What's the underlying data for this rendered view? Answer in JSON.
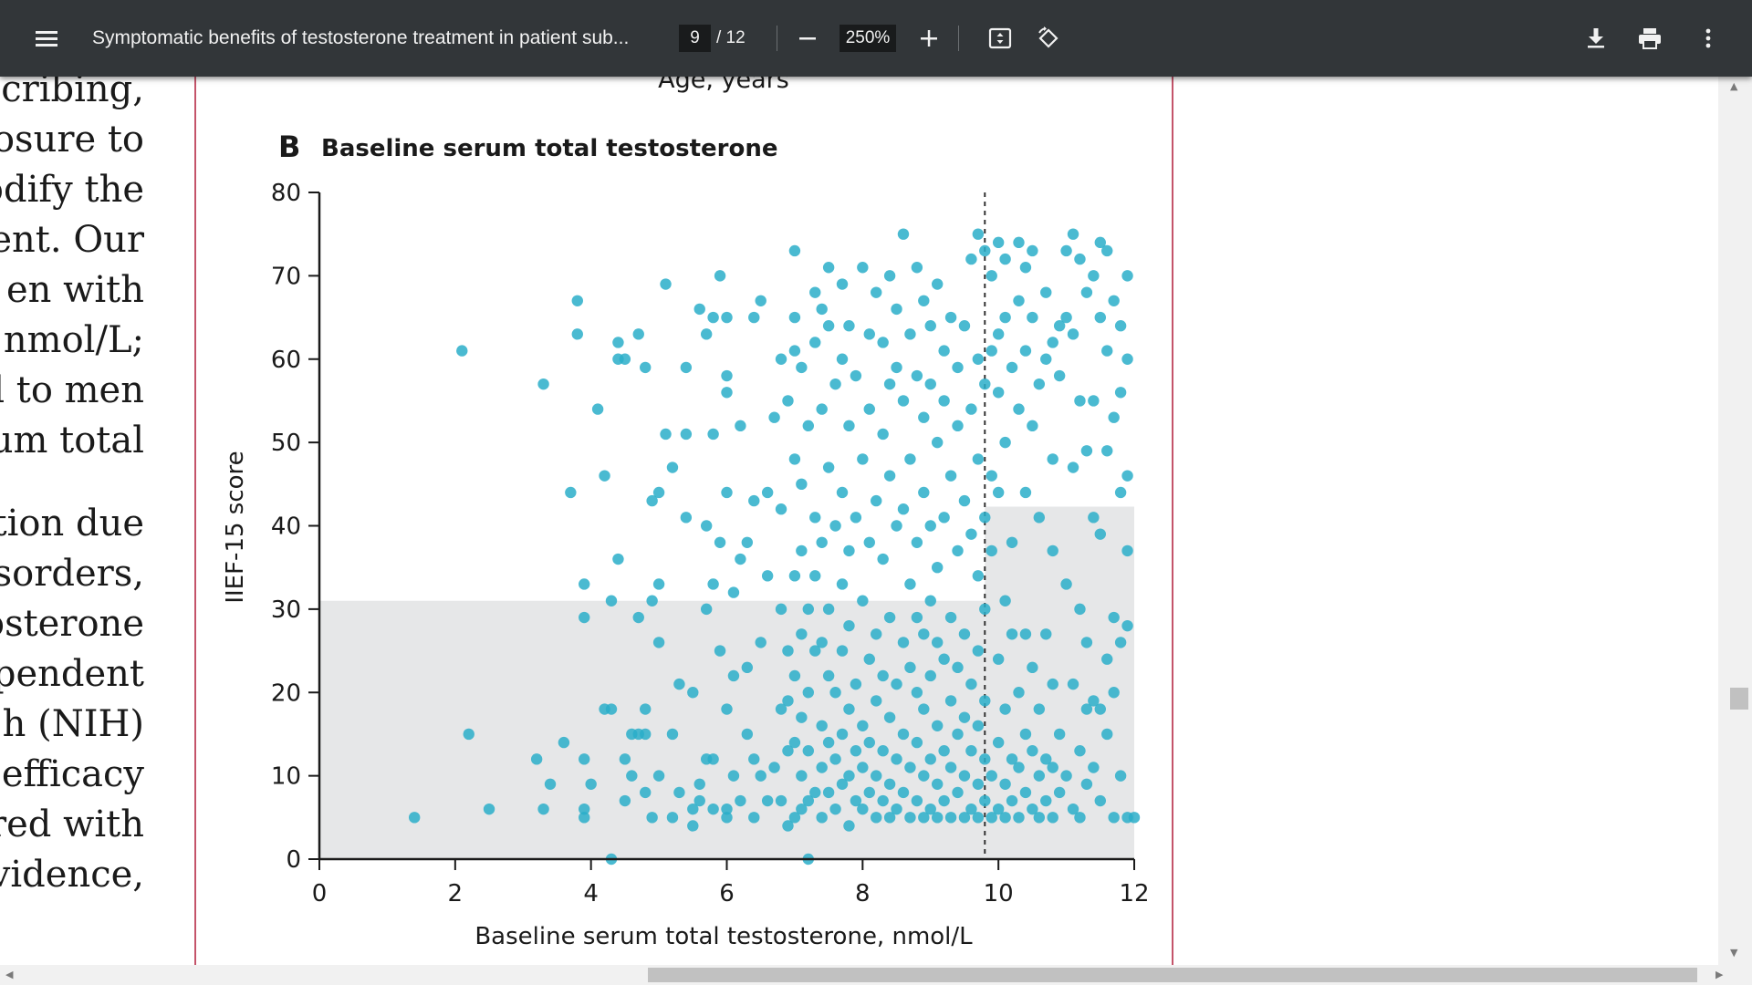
{
  "toolbar": {
    "menu_icon": "hamburger-menu-icon",
    "title": "Symptomatic benefits of testosterone treatment in patient sub...",
    "current_page": "9",
    "total_pages": "/ 12",
    "zoom": "250%",
    "icons": [
      "zoom-out-icon",
      "zoom-in-icon",
      "fit-page-icon",
      "rotate-icon",
      "download-icon",
      "print-icon",
      "more-vert-icon"
    ]
  },
  "left_text_lines": [
    "scribing,",
    "osure to",
    "odify the",
    "ent. Our",
    "en   with",
    "nmol/L;",
    "d to men",
    "um total",
    "tion due",
    "isorders,",
    "osterone",
    "pendent",
    "h  (NIH)",
    "efficacy",
    "red with",
    "vidence,"
  ],
  "figure": {
    "previous_xlabel": "Age, years",
    "panel_label": "B",
    "panel_title": "Baseline serum total testosterone"
  },
  "chart_data": {
    "type": "scatter",
    "title": "Baseline serum total testosterone",
    "xlabel": "Baseline serum total testosterone, nmol/L",
    "ylabel": "IIEF-15 score",
    "xlim": [
      0,
      12
    ],
    "ylim": [
      0,
      80
    ],
    "xticks": [
      "0",
      "2",
      "4",
      "6",
      "8",
      "10",
      "12"
    ],
    "yticks": [
      "0",
      "10",
      "20",
      "30",
      "40",
      "50",
      "60",
      "70",
      "80"
    ],
    "reference_line_x": 9.8,
    "shaded_regions": [
      {
        "x0": 0,
        "x1": 9.8,
        "y0": 0,
        "y1": 31
      },
      {
        "x0": 9.8,
        "x1": 12,
        "y0": 0,
        "y1": 42.3
      }
    ],
    "point_color": "#2aaec9",
    "shade_color": "#e6e7e8",
    "points": [
      [
        1.4,
        5
      ],
      [
        2.1,
        61
      ],
      [
        2.2,
        15
      ],
      [
        2.5,
        6
      ],
      [
        3.3,
        57
      ],
      [
        3.2,
        12
      ],
      [
        3.3,
        6
      ],
      [
        3.4,
        9
      ],
      [
        3.6,
        14
      ],
      [
        3.7,
        44
      ],
      [
        3.8,
        67
      ],
      [
        3.8,
        63
      ],
      [
        3.9,
        6
      ],
      [
        3.9,
        12
      ],
      [
        3.9,
        29
      ],
      [
        3.9,
        33
      ],
      [
        3.9,
        5
      ],
      [
        4.0,
        9
      ],
      [
        4.1,
        54
      ],
      [
        4.2,
        18
      ],
      [
        4.2,
        46
      ],
      [
        4.3,
        18
      ],
      [
        4.3,
        31
      ],
      [
        4.3,
        0
      ],
      [
        4.4,
        36
      ],
      [
        4.4,
        62
      ],
      [
        4.4,
        60
      ],
      [
        4.5,
        7
      ],
      [
        4.5,
        12
      ],
      [
        4.5,
        60
      ],
      [
        4.6,
        15
      ],
      [
        4.6,
        10
      ],
      [
        4.7,
        15
      ],
      [
        4.7,
        29
      ],
      [
        4.7,
        63
      ],
      [
        4.8,
        59
      ],
      [
        4.8,
        18
      ],
      [
        4.8,
        8
      ],
      [
        4.8,
        15
      ],
      [
        4.9,
        31
      ],
      [
        4.9,
        43
      ],
      [
        4.9,
        5
      ],
      [
        5.0,
        10
      ],
      [
        5.0,
        44
      ],
      [
        5.0,
        33
      ],
      [
        5.0,
        26
      ],
      [
        5.1,
        51
      ],
      [
        5.1,
        69
      ],
      [
        5.2,
        47
      ],
      [
        5.2,
        15
      ],
      [
        5.2,
        5
      ],
      [
        5.3,
        8
      ],
      [
        5.3,
        21
      ],
      [
        5.4,
        41
      ],
      [
        5.4,
        51
      ],
      [
        5.4,
        59
      ],
      [
        5.5,
        6
      ],
      [
        5.5,
        4
      ],
      [
        5.5,
        20
      ],
      [
        5.6,
        9
      ],
      [
        5.6,
        66
      ],
      [
        5.6,
        7
      ],
      [
        5.7,
        12
      ],
      [
        5.7,
        63
      ],
      [
        5.7,
        40
      ],
      [
        5.7,
        30
      ],
      [
        5.8,
        65
      ],
      [
        5.8,
        51
      ],
      [
        5.8,
        33
      ],
      [
        5.8,
        6
      ],
      [
        5.8,
        12
      ],
      [
        5.9,
        25
      ],
      [
        5.9,
        38
      ],
      [
        5.9,
        70
      ],
      [
        6.0,
        6
      ],
      [
        6.0,
        5
      ],
      [
        6.0,
        56
      ],
      [
        6.0,
        18
      ],
      [
        6.0,
        44
      ],
      [
        6.0,
        58
      ],
      [
        6.0,
        65
      ],
      [
        6.1,
        10
      ],
      [
        6.1,
        22
      ],
      [
        6.1,
        32
      ],
      [
        6.2,
        36
      ],
      [
        6.2,
        7
      ],
      [
        6.2,
        52
      ],
      [
        6.3,
        15
      ],
      [
        6.3,
        23
      ],
      [
        6.3,
        38
      ],
      [
        6.4,
        12
      ],
      [
        6.4,
        5
      ],
      [
        6.4,
        43
      ],
      [
        6.4,
        65
      ],
      [
        6.5,
        10
      ],
      [
        6.5,
        26
      ],
      [
        6.5,
        67
      ],
      [
        6.6,
        7
      ],
      [
        6.6,
        34
      ],
      [
        6.6,
        44
      ],
      [
        6.7,
        11
      ],
      [
        6.7,
        53
      ],
      [
        6.8,
        7
      ],
      [
        6.8,
        18
      ],
      [
        6.8,
        30
      ],
      [
        6.8,
        42
      ],
      [
        6.8,
        60
      ],
      [
        6.9,
        4
      ],
      [
        6.9,
        13
      ],
      [
        6.9,
        19
      ],
      [
        6.9,
        25
      ],
      [
        6.9,
        55
      ],
      [
        7.0,
        5
      ],
      [
        7.0,
        14
      ],
      [
        7.0,
        22
      ],
      [
        7.0,
        34
      ],
      [
        7.0,
        48
      ],
      [
        7.0,
        61
      ],
      [
        7.0,
        65
      ],
      [
        7.0,
        73
      ],
      [
        7.1,
        6
      ],
      [
        7.1,
        10
      ],
      [
        7.1,
        17
      ],
      [
        7.1,
        27
      ],
      [
        7.1,
        37
      ],
      [
        7.1,
        45
      ],
      [
        7.1,
        59
      ],
      [
        7.2,
        7
      ],
      [
        7.2,
        13
      ],
      [
        7.2,
        20
      ],
      [
        7.2,
        30
      ],
      [
        7.2,
        52
      ],
      [
        7.2,
        0
      ],
      [
        7.3,
        8
      ],
      [
        7.3,
        25
      ],
      [
        7.3,
        34
      ],
      [
        7.3,
        41
      ],
      [
        7.3,
        62
      ],
      [
        7.3,
        68
      ],
      [
        7.4,
        5
      ],
      [
        7.4,
        11
      ],
      [
        7.4,
        16
      ],
      [
        7.4,
        26
      ],
      [
        7.4,
        38
      ],
      [
        7.4,
        54
      ],
      [
        7.4,
        66
      ],
      [
        7.5,
        8
      ],
      [
        7.5,
        14
      ],
      [
        7.5,
        22
      ],
      [
        7.5,
        30
      ],
      [
        7.5,
        47
      ],
      [
        7.5,
        64
      ],
      [
        7.5,
        71
      ],
      [
        7.6,
        6
      ],
      [
        7.6,
        12
      ],
      [
        7.6,
        20
      ],
      [
        7.6,
        40
      ],
      [
        7.6,
        57
      ],
      [
        7.7,
        9
      ],
      [
        7.7,
        15
      ],
      [
        7.7,
        25
      ],
      [
        7.7,
        33
      ],
      [
        7.7,
        44
      ],
      [
        7.7,
        60
      ],
      [
        7.7,
        69
      ],
      [
        7.8,
        4
      ],
      [
        7.8,
        10
      ],
      [
        7.8,
        18
      ],
      [
        7.8,
        28
      ],
      [
        7.8,
        37
      ],
      [
        7.8,
        52
      ],
      [
        7.8,
        64
      ],
      [
        7.9,
        7
      ],
      [
        7.9,
        13
      ],
      [
        7.9,
        21
      ],
      [
        7.9,
        41
      ],
      [
        7.9,
        58
      ],
      [
        8.0,
        6
      ],
      [
        8.0,
        11
      ],
      [
        8.0,
        16
      ],
      [
        8.0,
        31
      ],
      [
        8.0,
        48
      ],
      [
        8.0,
        71
      ],
      [
        8.1,
        8
      ],
      [
        8.1,
        14
      ],
      [
        8.1,
        24
      ],
      [
        8.1,
        38
      ],
      [
        8.1,
        54
      ],
      [
        8.1,
        63
      ],
      [
        8.2,
        5
      ],
      [
        8.2,
        10
      ],
      [
        8.2,
        19
      ],
      [
        8.2,
        27
      ],
      [
        8.2,
        43
      ],
      [
        8.2,
        68
      ],
      [
        8.3,
        7
      ],
      [
        8.3,
        13
      ],
      [
        8.3,
        22
      ],
      [
        8.3,
        36
      ],
      [
        8.3,
        51
      ],
      [
        8.3,
        62
      ],
      [
        8.4,
        5
      ],
      [
        8.4,
        9
      ],
      [
        8.4,
        17
      ],
      [
        8.4,
        29
      ],
      [
        8.4,
        46
      ],
      [
        8.4,
        57
      ],
      [
        8.4,
        70
      ],
      [
        8.5,
        6
      ],
      [
        8.5,
        12
      ],
      [
        8.5,
        21
      ],
      [
        8.5,
        40
      ],
      [
        8.5,
        59
      ],
      [
        8.5,
        66
      ],
      [
        8.6,
        8
      ],
      [
        8.6,
        15
      ],
      [
        8.6,
        26
      ],
      [
        8.6,
        42
      ],
      [
        8.6,
        55
      ],
      [
        8.6,
        75
      ],
      [
        8.7,
        5
      ],
      [
        8.7,
        11
      ],
      [
        8.7,
        23
      ],
      [
        8.7,
        33
      ],
      [
        8.7,
        48
      ],
      [
        8.7,
        63
      ],
      [
        8.8,
        7
      ],
      [
        8.8,
        14
      ],
      [
        8.8,
        20
      ],
      [
        8.8,
        29
      ],
      [
        8.8,
        38
      ],
      [
        8.8,
        58
      ],
      [
        8.8,
        71
      ],
      [
        8.9,
        5
      ],
      [
        8.9,
        10
      ],
      [
        8.9,
        18
      ],
      [
        8.9,
        27
      ],
      [
        8.9,
        44
      ],
      [
        8.9,
        53
      ],
      [
        8.9,
        67
      ],
      [
        9.0,
        6
      ],
      [
        9.0,
        12
      ],
      [
        9.0,
        22
      ],
      [
        9.0,
        31
      ],
      [
        9.0,
        40
      ],
      [
        9.0,
        57
      ],
      [
        9.0,
        64
      ],
      [
        9.1,
        5
      ],
      [
        9.1,
        9
      ],
      [
        9.1,
        16
      ],
      [
        9.1,
        26
      ],
      [
        9.1,
        35
      ],
      [
        9.1,
        50
      ],
      [
        9.1,
        69
      ],
      [
        9.2,
        7
      ],
      [
        9.2,
        13
      ],
      [
        9.2,
        24
      ],
      [
        9.2,
        41
      ],
      [
        9.2,
        55
      ],
      [
        9.2,
        61
      ],
      [
        9.3,
        5
      ],
      [
        9.3,
        11
      ],
      [
        9.3,
        19
      ],
      [
        9.3,
        29
      ],
      [
        9.3,
        46
      ],
      [
        9.3,
        65
      ],
      [
        9.4,
        8
      ],
      [
        9.4,
        15
      ],
      [
        9.4,
        23
      ],
      [
        9.4,
        37
      ],
      [
        9.4,
        52
      ],
      [
        9.4,
        59
      ],
      [
        9.5,
        5
      ],
      [
        9.5,
        10
      ],
      [
        9.5,
        17
      ],
      [
        9.5,
        27
      ],
      [
        9.5,
        43
      ],
      [
        9.5,
        64
      ],
      [
        9.6,
        6
      ],
      [
        9.6,
        13
      ],
      [
        9.6,
        21
      ],
      [
        9.6,
        39
      ],
      [
        9.6,
        54
      ],
      [
        9.6,
        72
      ],
      [
        9.7,
        5
      ],
      [
        9.7,
        9
      ],
      [
        9.7,
        16
      ],
      [
        9.7,
        25
      ],
      [
        9.7,
        34
      ],
      [
        9.7,
        48
      ],
      [
        9.7,
        60
      ],
      [
        9.7,
        75
      ],
      [
        9.8,
        7
      ],
      [
        9.8,
        12
      ],
      [
        9.8,
        19
      ],
      [
        9.8,
        30
      ],
      [
        9.8,
        41
      ],
      [
        9.8,
        57
      ],
      [
        9.8,
        73
      ],
      [
        9.9,
        5
      ],
      [
        9.9,
        10
      ],
      [
        9.9,
        37
      ],
      [
        9.9,
        46
      ],
      [
        9.9,
        61
      ],
      [
        9.9,
        70
      ],
      [
        10.0,
        6
      ],
      [
        10.0,
        14
      ],
      [
        10.0,
        24
      ],
      [
        10.0,
        44
      ],
      [
        10.0,
        56
      ],
      [
        10.0,
        63
      ],
      [
        10.0,
        74
      ],
      [
        10.1,
        5
      ],
      [
        10.1,
        9
      ],
      [
        10.1,
        18
      ],
      [
        10.1,
        31
      ],
      [
        10.1,
        50
      ],
      [
        10.1,
        65
      ],
      [
        10.1,
        72
      ],
      [
        10.2,
        7
      ],
      [
        10.2,
        12
      ],
      [
        10.2,
        27
      ],
      [
        10.2,
        38
      ],
      [
        10.2,
        59
      ],
      [
        10.3,
        5
      ],
      [
        10.3,
        11
      ],
      [
        10.3,
        20
      ],
      [
        10.3,
        54
      ],
      [
        10.3,
        67
      ],
      [
        10.3,
        74
      ],
      [
        10.4,
        8
      ],
      [
        10.4,
        15
      ],
      [
        10.4,
        27
      ],
      [
        10.4,
        44
      ],
      [
        10.4,
        61
      ],
      [
        10.4,
        71
      ],
      [
        10.5,
        6
      ],
      [
        10.5,
        13
      ],
      [
        10.5,
        23
      ],
      [
        10.5,
        52
      ],
      [
        10.5,
        65
      ],
      [
        10.5,
        73
      ],
      [
        10.6,
        5
      ],
      [
        10.6,
        10
      ],
      [
        10.6,
        18
      ],
      [
        10.6,
        41
      ],
      [
        10.6,
        57
      ],
      [
        10.7,
        7
      ],
      [
        10.7,
        12
      ],
      [
        10.7,
        27
      ],
      [
        10.7,
        60
      ],
      [
        10.7,
        68
      ],
      [
        10.8,
        5
      ],
      [
        10.8,
        11
      ],
      [
        10.8,
        21
      ],
      [
        10.8,
        37
      ],
      [
        10.8,
        48
      ],
      [
        10.8,
        62
      ],
      [
        10.9,
        8
      ],
      [
        10.9,
        15
      ],
      [
        10.9,
        58
      ],
      [
        10.9,
        64
      ],
      [
        11.0,
        10
      ],
      [
        11.0,
        33
      ],
      [
        11.0,
        65
      ],
      [
        11.0,
        73
      ],
      [
        11.1,
        6
      ],
      [
        11.1,
        21
      ],
      [
        11.1,
        47
      ],
      [
        11.1,
        63
      ],
      [
        11.1,
        75
      ],
      [
        11.2,
        5
      ],
      [
        11.2,
        13
      ],
      [
        11.2,
        30
      ],
      [
        11.2,
        55
      ],
      [
        11.2,
        72
      ],
      [
        11.3,
        9
      ],
      [
        11.3,
        18
      ],
      [
        11.3,
        26
      ],
      [
        11.3,
        49
      ],
      [
        11.3,
        68
      ],
      [
        11.4,
        11
      ],
      [
        11.4,
        19
      ],
      [
        11.4,
        41
      ],
      [
        11.4,
        55
      ],
      [
        11.4,
        70
      ],
      [
        11.5,
        7
      ],
      [
        11.5,
        18
      ],
      [
        11.5,
        39
      ],
      [
        11.5,
        65
      ],
      [
        11.5,
        74
      ],
      [
        11.6,
        15
      ],
      [
        11.6,
        24
      ],
      [
        11.6,
        49
      ],
      [
        11.6,
        61
      ],
      [
        11.6,
        73
      ],
      [
        11.7,
        5
      ],
      [
        11.7,
        20
      ],
      [
        11.7,
        29
      ],
      [
        11.7,
        53
      ],
      [
        11.7,
        67
      ],
      [
        11.8,
        10
      ],
      [
        11.8,
        26
      ],
      [
        11.8,
        44
      ],
      [
        11.8,
        56
      ],
      [
        11.8,
        64
      ],
      [
        11.9,
        5
      ],
      [
        11.9,
        28
      ],
      [
        11.9,
        37
      ],
      [
        11.9,
        46
      ],
      [
        11.9,
        60
      ],
      [
        11.9,
        70
      ],
      [
        12.0,
        5
      ]
    ]
  }
}
